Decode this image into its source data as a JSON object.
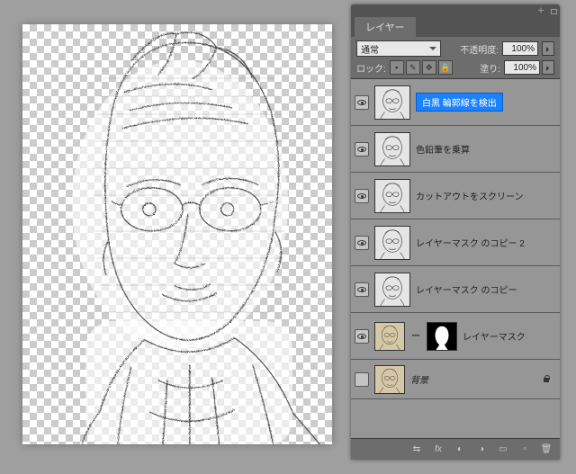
{
  "panel": {
    "title": "レイヤー",
    "blend_mode": "通常",
    "opacity_label": "不透明度:",
    "opacity_value": "100%",
    "lock_label": "ロック:",
    "fill_label": "塗り:",
    "fill_value": "100%",
    "lock_icons": [
      "▪",
      "✎",
      "✥",
      "🔒"
    ]
  },
  "layers": [
    {
      "name": "白黒 輪郭線を検出",
      "visible": true,
      "selected": true
    },
    {
      "name": "色鉛筆を乗算",
      "visible": true,
      "selected": false
    },
    {
      "name": "カットアウトをスクリーン",
      "visible": true,
      "selected": false
    },
    {
      "name": "レイヤーマスク のコピー 2",
      "visible": true,
      "selected": false
    },
    {
      "name": "レイヤーマスク のコピー",
      "visible": true,
      "selected": false
    },
    {
      "name": "レイヤーマスク",
      "visible": true,
      "selected": false,
      "has_mask": true
    },
    {
      "name": "背景",
      "visible": false,
      "selected": false,
      "locked": true,
      "is_bg": true
    }
  ],
  "footer_icons": [
    "link",
    "fx",
    "mask",
    "adjust",
    "group",
    "new",
    "trash"
  ]
}
